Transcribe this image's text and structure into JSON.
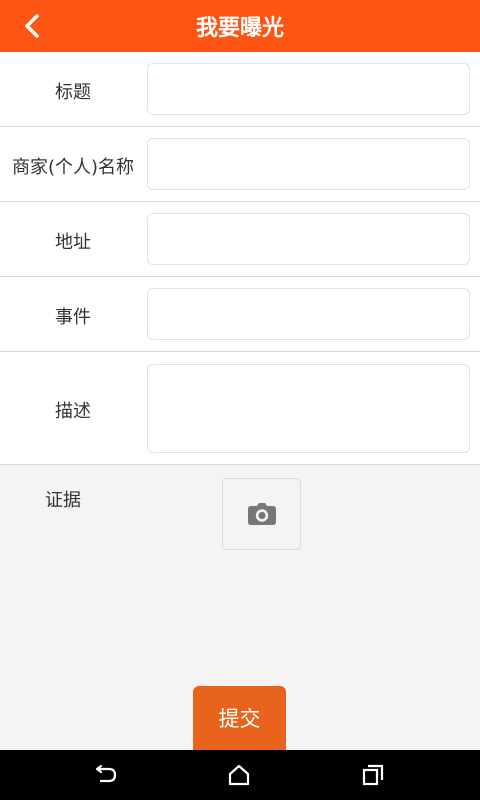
{
  "header": {
    "title": "我要曝光",
    "back_icon": "chevron-left-icon"
  },
  "form": {
    "fields": [
      {
        "label": "标题",
        "value": "",
        "placeholder": ""
      },
      {
        "label": "商家(个人)名称",
        "value": "",
        "placeholder": ""
      },
      {
        "label": "地址",
        "value": "",
        "placeholder": ""
      },
      {
        "label": "事件",
        "value": "",
        "placeholder": ""
      },
      {
        "label": "描述",
        "value": "",
        "placeholder": ""
      }
    ],
    "evidence_label": "证据",
    "camera_icon": "camera-icon"
  },
  "submit_label": "提交",
  "nav": {
    "icons": [
      "back-icon",
      "home-icon",
      "recent-apps-icon"
    ]
  },
  "colors": {
    "header": "#ff5514",
    "submit": "#e8641c",
    "background": "#f4f4f4"
  }
}
